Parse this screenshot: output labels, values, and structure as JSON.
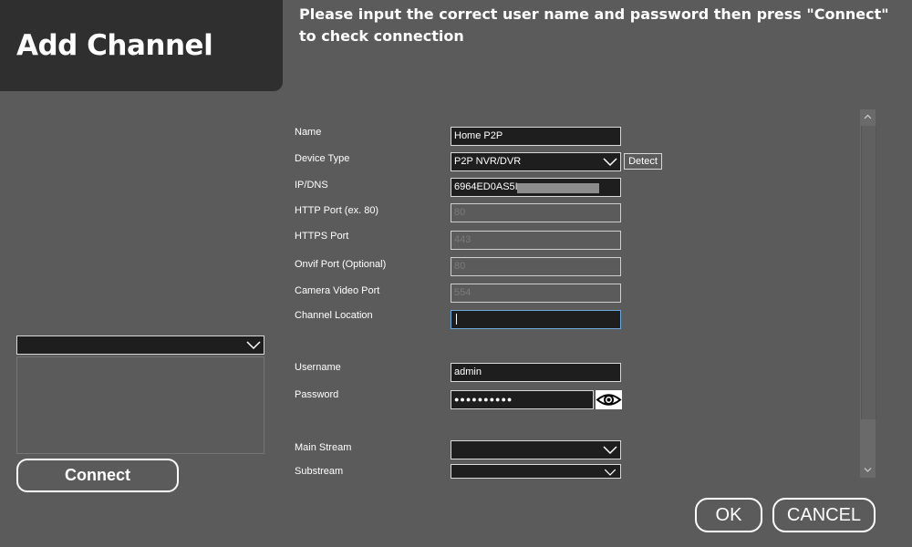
{
  "header": {
    "title": "Add Channel",
    "instruction": "Please input the correct user name and password then press \"Connect\" to check connection"
  },
  "form": {
    "name": {
      "label": "Name",
      "value": "Home P2P"
    },
    "device_type": {
      "label": "Device Type",
      "value": "P2P NVR/DVR",
      "detect_label": "Detect"
    },
    "ip_dns": {
      "label": "IP/DNS",
      "value": "6964ED0AS5I"
    },
    "http_port": {
      "label": "HTTP Port (ex. 80)",
      "value": "80"
    },
    "https_port": {
      "label": "HTTPS Port",
      "value": "443"
    },
    "onvif_port": {
      "label": "Onvif Port (Optional)",
      "value": "80"
    },
    "camera_video_port": {
      "label": "Camera Video Port",
      "value": "554"
    },
    "channel_location": {
      "label": "Channel Location",
      "value": ""
    },
    "username": {
      "label": "Username",
      "value": "admin"
    },
    "password": {
      "label": "Password",
      "value": "●●●●●●●●●●"
    },
    "main_stream": {
      "label": "Main Stream",
      "value": ""
    },
    "substream": {
      "label": "Substream",
      "value": ""
    }
  },
  "buttons": {
    "connect": "Connect",
    "ok": "OK",
    "cancel": "CANCEL"
  },
  "icons": {
    "eye": "eye-icon",
    "dropdown": "chevron-down-icon"
  },
  "colors": {
    "background": "#5b5b5b",
    "panel": "#2f2f2f",
    "field": "#1e1e1e"
  }
}
